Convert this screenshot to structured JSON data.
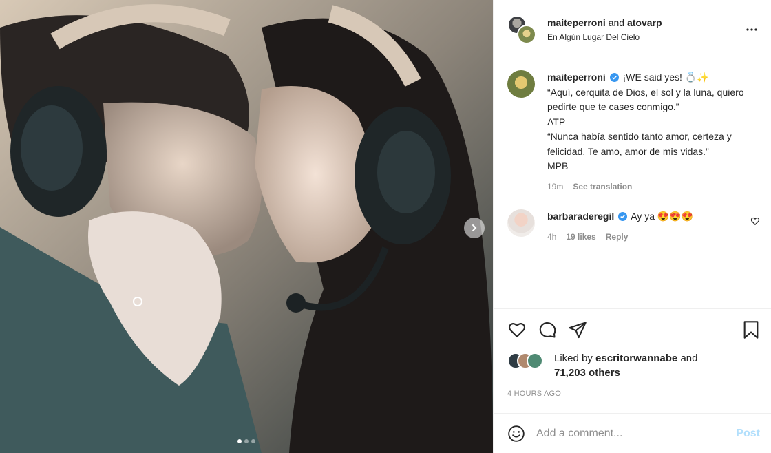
{
  "header": {
    "user1": "maiteperroni",
    "joiner": "and",
    "user2": "atovarp",
    "location": "En Algún Lugar Del Cielo",
    "more_icon": "more-horizontal-icon"
  },
  "caption": {
    "username": "maiteperroni",
    "first_line": "¡WE said yes! 💍✨",
    "lines": [
      "“Aquí, cerquita de Dios, el sol y la luna, quiero pedirte que te cases conmigo.”",
      "ATP",
      "“Nunca había sentido tanto amor, certeza y felicidad. Te amo, amor de mis vidas.”",
      "MPB"
    ],
    "time": "19m",
    "see_translation": "See translation"
  },
  "comment": {
    "username": "barbaraderegil",
    "text": "Ay ya 😍😍😍",
    "time": "4h",
    "likes": "19 likes",
    "reply": "Reply"
  },
  "likes": {
    "prefix": "Liked by",
    "user": "escritorwannabe",
    "joiner": "and",
    "count": "71,203 others"
  },
  "timestamp": "4 HOURS AGO",
  "add_comment": {
    "placeholder": "Add a comment...",
    "post_label": "Post"
  },
  "carousel": {
    "slides": 3,
    "active": 1
  },
  "colors": {
    "link_disabled": "#b2dffc",
    "verified": "#3897f0",
    "muted": "#8e8e8e"
  }
}
